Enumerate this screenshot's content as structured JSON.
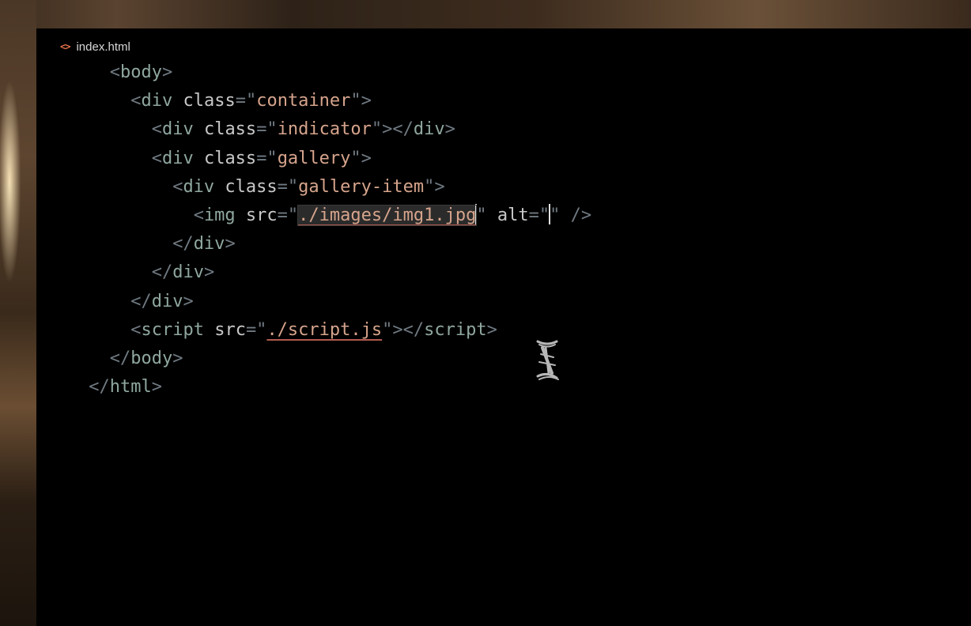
{
  "tab": {
    "icon": "code-brackets-icon",
    "filename": "index.html"
  },
  "lines": [
    {
      "indent": "    ",
      "parts": [
        {
          "t": "punct",
          "v": "<"
        },
        {
          "t": "tag",
          "v": "body"
        },
        {
          "t": "punct",
          "v": ">"
        }
      ]
    },
    {
      "indent": "      ",
      "parts": [
        {
          "t": "punct",
          "v": "<"
        },
        {
          "t": "tag",
          "v": "div"
        },
        {
          "t": "attr",
          "v": " class"
        },
        {
          "t": "eq",
          "v": "=\""
        },
        {
          "t": "str",
          "v": "container"
        },
        {
          "t": "eq",
          "v": "\""
        },
        {
          "t": "punct",
          "v": ">"
        }
      ]
    },
    {
      "indent": "        ",
      "parts": [
        {
          "t": "punct",
          "v": "<"
        },
        {
          "t": "tag",
          "v": "div"
        },
        {
          "t": "attr",
          "v": " class"
        },
        {
          "t": "eq",
          "v": "=\""
        },
        {
          "t": "str",
          "v": "indicator"
        },
        {
          "t": "eq",
          "v": "\""
        },
        {
          "t": "punct",
          "v": "></"
        },
        {
          "t": "tag",
          "v": "div"
        },
        {
          "t": "punct",
          "v": ">"
        }
      ]
    },
    {
      "indent": "        ",
      "parts": [
        {
          "t": "punct",
          "v": "<"
        },
        {
          "t": "tag",
          "v": "div"
        },
        {
          "t": "attr",
          "v": " class"
        },
        {
          "t": "eq",
          "v": "=\""
        },
        {
          "t": "str",
          "v": "gallery"
        },
        {
          "t": "eq",
          "v": "\""
        },
        {
          "t": "punct",
          "v": ">"
        }
      ]
    },
    {
      "indent": "          ",
      "parts": [
        {
          "t": "punct",
          "v": "<"
        },
        {
          "t": "tag",
          "v": "div"
        },
        {
          "t": "attr",
          "v": " class"
        },
        {
          "t": "eq",
          "v": "=\""
        },
        {
          "t": "str",
          "v": "gallery-item"
        },
        {
          "t": "eq",
          "v": "\""
        },
        {
          "t": "punct",
          "v": ">"
        }
      ]
    },
    {
      "indent": "            ",
      "parts": [
        {
          "t": "punct",
          "v": "<"
        },
        {
          "t": "tag",
          "v": "img"
        },
        {
          "t": "attr",
          "v": " src"
        },
        {
          "t": "eq",
          "v": "=\""
        },
        {
          "t": "str-url selected",
          "v": "./images/img1.jpg"
        },
        {
          "t": "caret",
          "v": ""
        },
        {
          "t": "eq",
          "v": "\""
        },
        {
          "t": "attr",
          "v": " alt"
        },
        {
          "t": "eq",
          "v": "=\""
        },
        {
          "t": "caret",
          "v": ""
        },
        {
          "t": "eq",
          "v": "\""
        },
        {
          "t": "punct",
          "v": " />"
        }
      ]
    },
    {
      "indent": "          ",
      "parts": [
        {
          "t": "punct",
          "v": "</"
        },
        {
          "t": "tag",
          "v": "div"
        },
        {
          "t": "punct",
          "v": ">"
        }
      ]
    },
    {
      "indent": "        ",
      "parts": [
        {
          "t": "punct",
          "v": "</"
        },
        {
          "t": "tag",
          "v": "div"
        },
        {
          "t": "punct",
          "v": ">"
        }
      ]
    },
    {
      "indent": "      ",
      "parts": [
        {
          "t": "punct",
          "v": "</"
        },
        {
          "t": "tag",
          "v": "div"
        },
        {
          "t": "punct",
          "v": ">"
        }
      ]
    },
    {
      "indent": "      ",
      "parts": [
        {
          "t": "punct",
          "v": "<"
        },
        {
          "t": "tag",
          "v": "script"
        },
        {
          "t": "attr",
          "v": " src"
        },
        {
          "t": "eq",
          "v": "=\""
        },
        {
          "t": "str-url",
          "v": "./script.js"
        },
        {
          "t": "eq",
          "v": "\""
        },
        {
          "t": "punct",
          "v": "></"
        },
        {
          "t": "tag",
          "v": "script"
        },
        {
          "t": "punct",
          "v": ">"
        }
      ]
    },
    {
      "indent": "    ",
      "parts": [
        {
          "t": "punct",
          "v": "</"
        },
        {
          "t": "tag",
          "v": "body"
        },
        {
          "t": "punct",
          "v": ">"
        }
      ]
    },
    {
      "indent": "  ",
      "parts": [
        {
          "t": "punct",
          "v": "</"
        },
        {
          "t": "tag",
          "v": "html"
        },
        {
          "t": "punct",
          "v": ">"
        }
      ]
    }
  ],
  "colors": {
    "background": "#000000",
    "tag": "#8fa7a0",
    "string": "#d6a48c",
    "attribute": "#c8c8c8",
    "punctuation": "#707a82",
    "tab_icon": "#e8744a"
  },
  "mouse_cursor": "text-ibeam-cursor-icon"
}
